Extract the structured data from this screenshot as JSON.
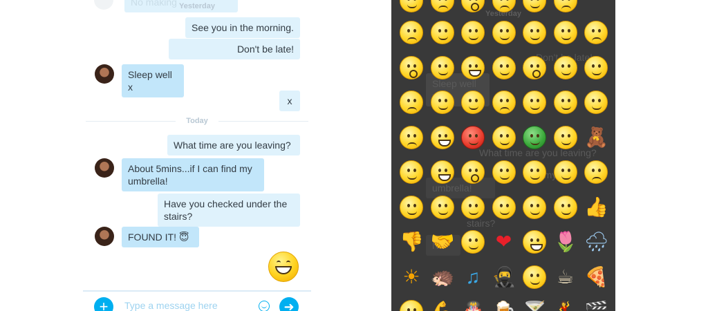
{
  "chat": {
    "day_yesterday": "Yesterday",
    "day_today": "Today",
    "top_partial": "No making",
    "messages": [
      {
        "text": "See you in the morning.",
        "dir": "out"
      },
      {
        "text": "Don't be late!",
        "dir": "out"
      },
      {
        "text": "Sleep well x",
        "dir": "in"
      },
      {
        "text": "x",
        "dir": "out"
      },
      {
        "text": "What time are you leaving?",
        "dir": "out"
      },
      {
        "text": "About 5mins...if I can find my umbrella!",
        "dir": "in"
      },
      {
        "text": "Have you checked under the stairs?",
        "dir": "out"
      },
      {
        "text": "FOUND IT! 😇",
        "dir": "in"
      }
    ],
    "big_emoji": "big-grin-emoticon",
    "composer": {
      "placeholder": "Type a message here",
      "add_icon": "plus-icon",
      "emoticon_icon": "smiley-icon",
      "send_icon": "arrow-right-icon"
    },
    "accent_color": "#00aff0"
  },
  "picker": {
    "ghost": {
      "day_yesterday": "Yesterday",
      "dont_be_late": "Don't be late!",
      "sleep_well": "Sleep well x",
      "what_time": "What time are you leaving?",
      "umbrella": "umbrella!",
      "stairs": "stairs?",
      "find_my": "d my",
      "found": "ND"
    },
    "background_color": "#393939",
    "rows": [
      [
        "smile-emoticon",
        "frown-emoticon",
        "surprised-emoticon",
        "crying-emoticon",
        "wink-emoticon",
        "sweat-emoticon"
      ],
      [
        "worried-emoticon",
        "smile-emoticon",
        "kiss-emoticon",
        "tongue-out-emoticon",
        "blush-emoticon",
        "raised-eyebrow-emoticon",
        "sleepy-emoticon"
      ],
      [
        "speechless-emoticon",
        "in-love-emoticon",
        "grin-emoticon",
        "wink-hand-emoticon",
        "yawn-emoticon",
        "puke-emoticon",
        "squint-emoticon"
      ],
      [
        "frown-emoticon",
        "thinking-emoticon",
        "party-emoticon",
        "worried-emoticon",
        "smirk-emoticon",
        "nerd-emoticon",
        "mouth-taped-emoticon"
      ],
      [
        "sweat-hand-emoticon",
        "laugh-hand-emoticon",
        "angry-emoticon",
        "angel-emoticon",
        "sick-emoticon",
        "doh-emoticon",
        "teddy-bear-icon"
      ],
      [
        "cool-emoticon",
        "giggle-emoticon",
        "shock-emoticon",
        "eye-roll-emoticon",
        "clapping-emoticon",
        "wave-emoticon",
        "sleepy-mask-emoticon"
      ],
      [
        "relieved-emoticon",
        "smug-emoticon",
        "hmm-emoticon",
        "wondering-emoticon",
        "wave-hand-emoticon",
        "ninja-emoticon",
        "thumbs-up-icon"
      ],
      [
        "thumbs-down-icon",
        "handshake-icon",
        "nod-emoticon",
        "heart-icon",
        "rofl-emoticon",
        "flower-icon",
        "rain-cloud-icon"
      ],
      [
        "sun-icon",
        "hedgehog-icon",
        "music-note-icon",
        "bandit-icon",
        "toast-emoticon",
        "coffee-icon",
        "pizza-icon"
      ],
      [
        "clock-emoticon",
        "muscle-icon",
        "cake-icon",
        "beer-icon",
        "cocktail-icon",
        "dancer-icon",
        "movie-icon"
      ]
    ]
  }
}
